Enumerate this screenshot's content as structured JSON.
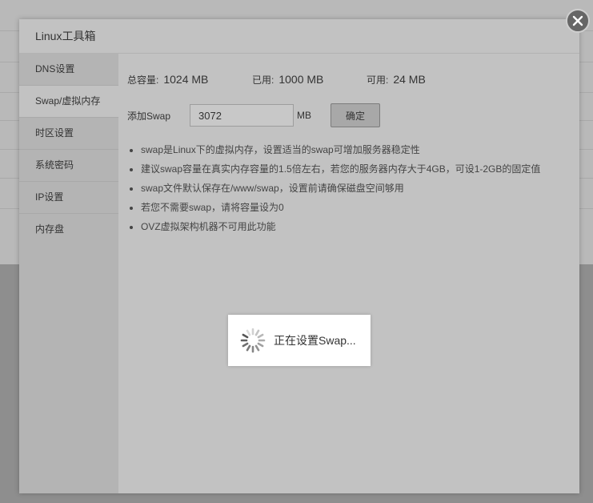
{
  "modal": {
    "title": "Linux工具箱"
  },
  "sidebar": {
    "items": [
      {
        "label": "DNS设置"
      },
      {
        "label": "Swap/虚拟内存"
      },
      {
        "label": "时区设置"
      },
      {
        "label": "系统密码"
      },
      {
        "label": "IP设置"
      },
      {
        "label": "内存盘"
      }
    ],
    "active_index": 1
  },
  "stats": {
    "total_label": "总容量:",
    "total_value": "1024 MB",
    "used_label": "已用:",
    "used_value": "1000 MB",
    "available_label": "可用:",
    "available_value": "24 MB"
  },
  "swap_form": {
    "label": "添加Swap",
    "value": "3072",
    "unit": "MB",
    "submit_label": "确定"
  },
  "tips": [
    "swap是Linux下的虚拟内存，设置适当的swap可增加服务器稳定性",
    "建议swap容量在真实内存容量的1.5倍左右，若您的服务器内存大于4GB，可设1-2GB的固定值",
    "swap文件默认保存在/www/swap，设置前请确保磁盘空间够用",
    "若您不需要swap，请将容量设为0",
    "OVZ虚拟架构机器不可用此功能"
  ],
  "loading": {
    "text": "正在设置Swap..."
  },
  "colors": {
    "spinner": "#555555",
    "overlay": "#8e8e8e"
  },
  "icons": {
    "close": "close-icon",
    "spinner": "spinner-icon"
  }
}
